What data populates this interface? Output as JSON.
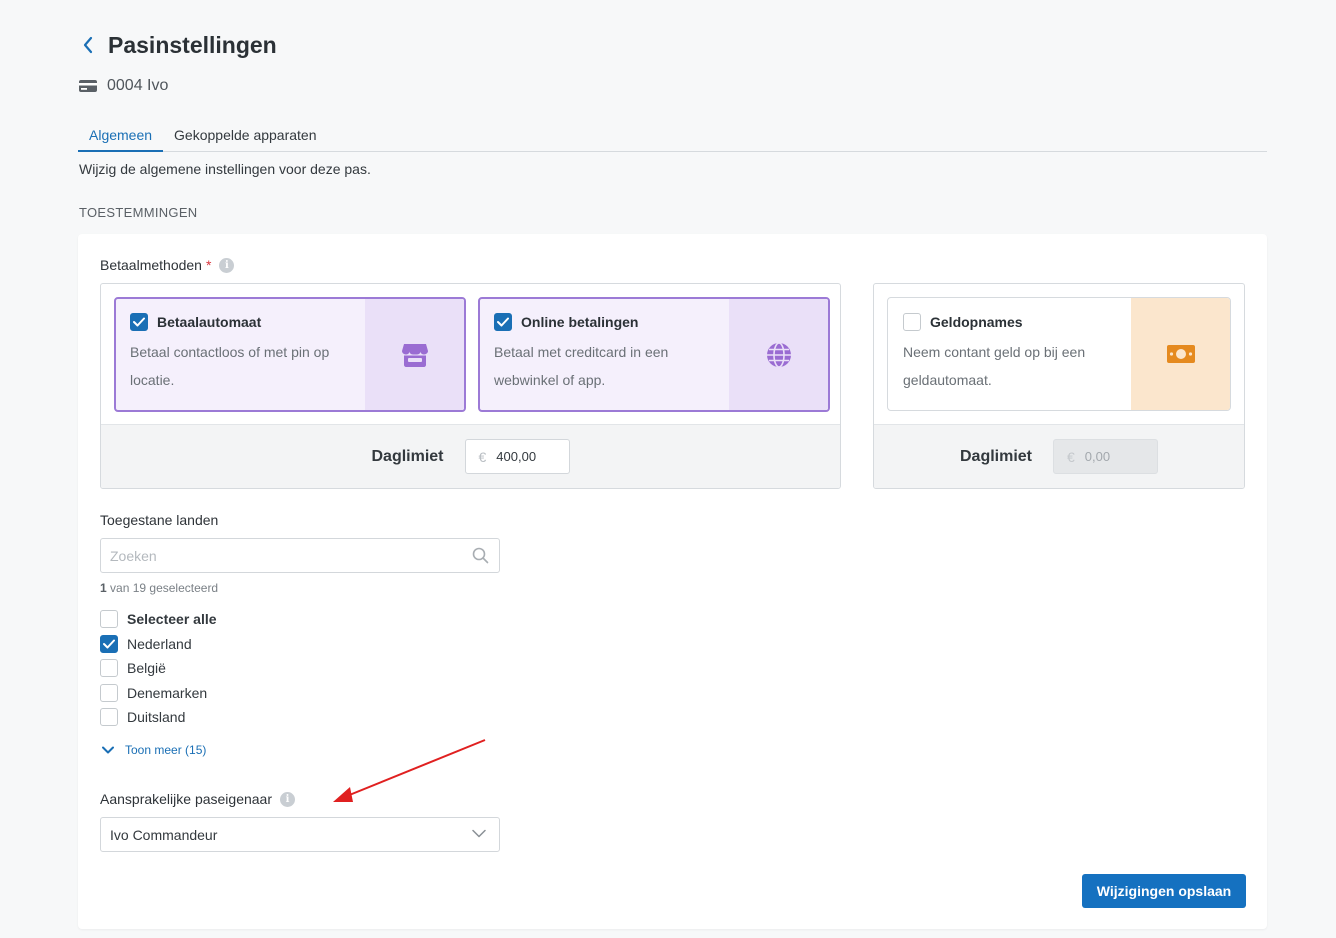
{
  "header": {
    "title": "Pasinstellingen",
    "card_label": "0004 Ivo"
  },
  "tabs": [
    {
      "label": "Algemeen",
      "active": true
    },
    {
      "label": "Gekoppelde apparaten",
      "active": false
    }
  ],
  "description": "Wijzig de algemene instellingen voor deze pas.",
  "section": "TOESTEMMINGEN",
  "payment_methods": {
    "label": "Betaalmethoden",
    "required_mark": "*",
    "options": [
      {
        "title": "Betaalautomaat",
        "description": "Betaal contactloos of met pin op locatie.",
        "checked": true,
        "icon": "store-icon"
      },
      {
        "title": "Online betalingen",
        "description": "Betaal met creditcard in een webwinkel of app.",
        "checked": true,
        "icon": "globe-icon"
      },
      {
        "title": "Geldopnames",
        "description": "Neem contant geld op bij een geldautomaat.",
        "checked": false,
        "icon": "cash-icon"
      }
    ],
    "limit_label": "Daglimiet",
    "currency": "€",
    "limit_payments": "400,00",
    "limit_withdrawals": "0,00"
  },
  "countries": {
    "label": "Toegestane landen",
    "search_placeholder": "Zoeken",
    "selected_count": "1",
    "selected_text": "van 19 geselecteerd",
    "select_all": "Selecteer alle",
    "items": [
      {
        "name": "Nederland",
        "checked": true
      },
      {
        "name": "België",
        "checked": false
      },
      {
        "name": "Denemarken",
        "checked": false
      },
      {
        "name": "Duitsland",
        "checked": false
      }
    ],
    "show_more": "Toon meer (15)"
  },
  "owner": {
    "label": "Aansprakelijke paseigenaar",
    "value": "Ivo Commandeur"
  },
  "save_label": "Wijzigingen opslaan",
  "colors": {
    "accent": "#1a6fb5",
    "purple": "#9c7ad6",
    "orange": "#e58a1f",
    "annotation": "#e02020"
  }
}
